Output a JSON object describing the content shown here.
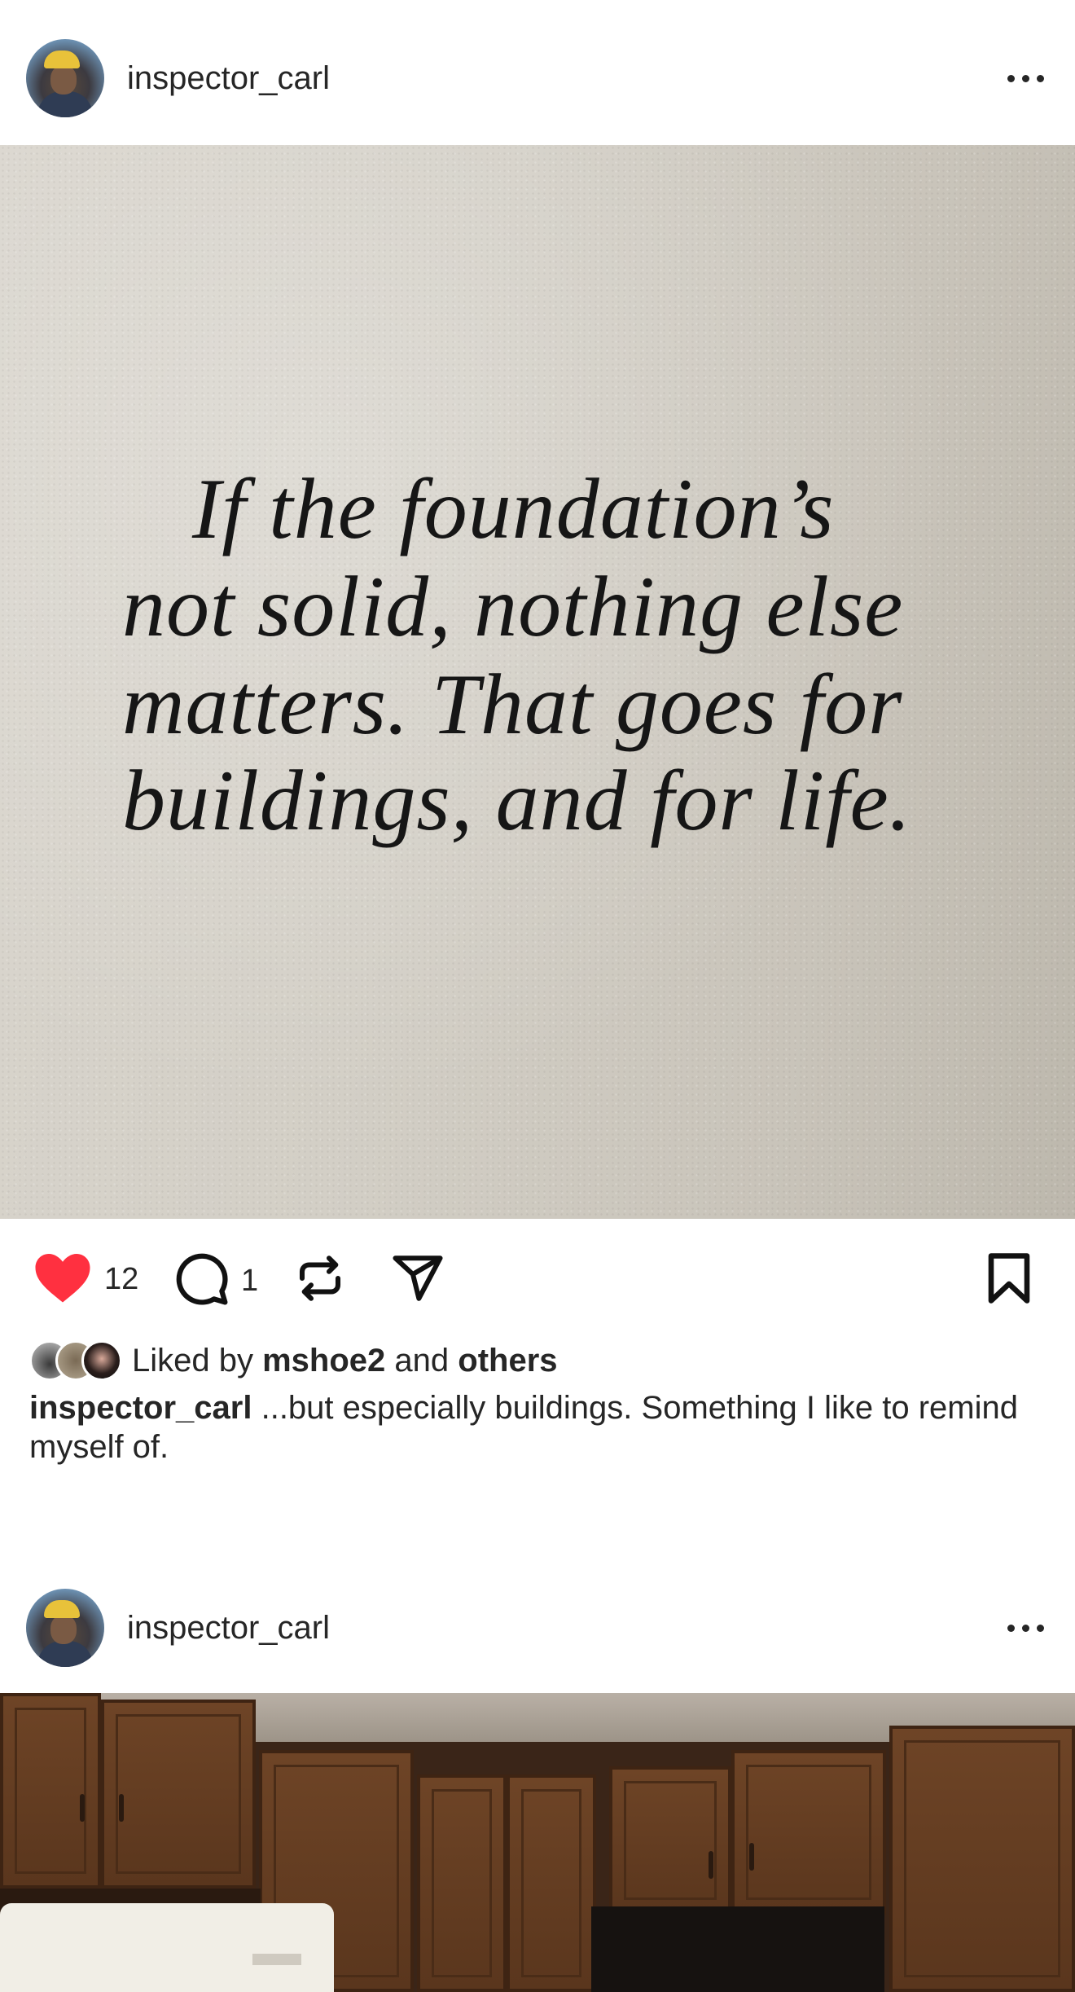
{
  "posts": [
    {
      "username": "inspector_carl",
      "quote_lines": [
        "If the foundation’s",
        "not solid, nothing else",
        "matters. That goes for",
        "buildings, and for life."
      ],
      "likes_count": "12",
      "comments_count": "1",
      "liked_by_prefix": "Liked by",
      "liked_by_user": "mshoe2",
      "liked_by_and": "and",
      "liked_by_others": "others",
      "caption_user": "inspector_carl",
      "caption_text": "...but especially buildings. Something I like to remind myself of."
    },
    {
      "username": "inspector_carl"
    }
  ],
  "icons": {
    "like": "heart-icon",
    "comment": "comment-icon",
    "repost": "repost-icon",
    "share": "send-icon",
    "save": "bookmark-icon",
    "more": "more-icon"
  },
  "colors": {
    "like": "#ff3040",
    "text": "#262626"
  }
}
